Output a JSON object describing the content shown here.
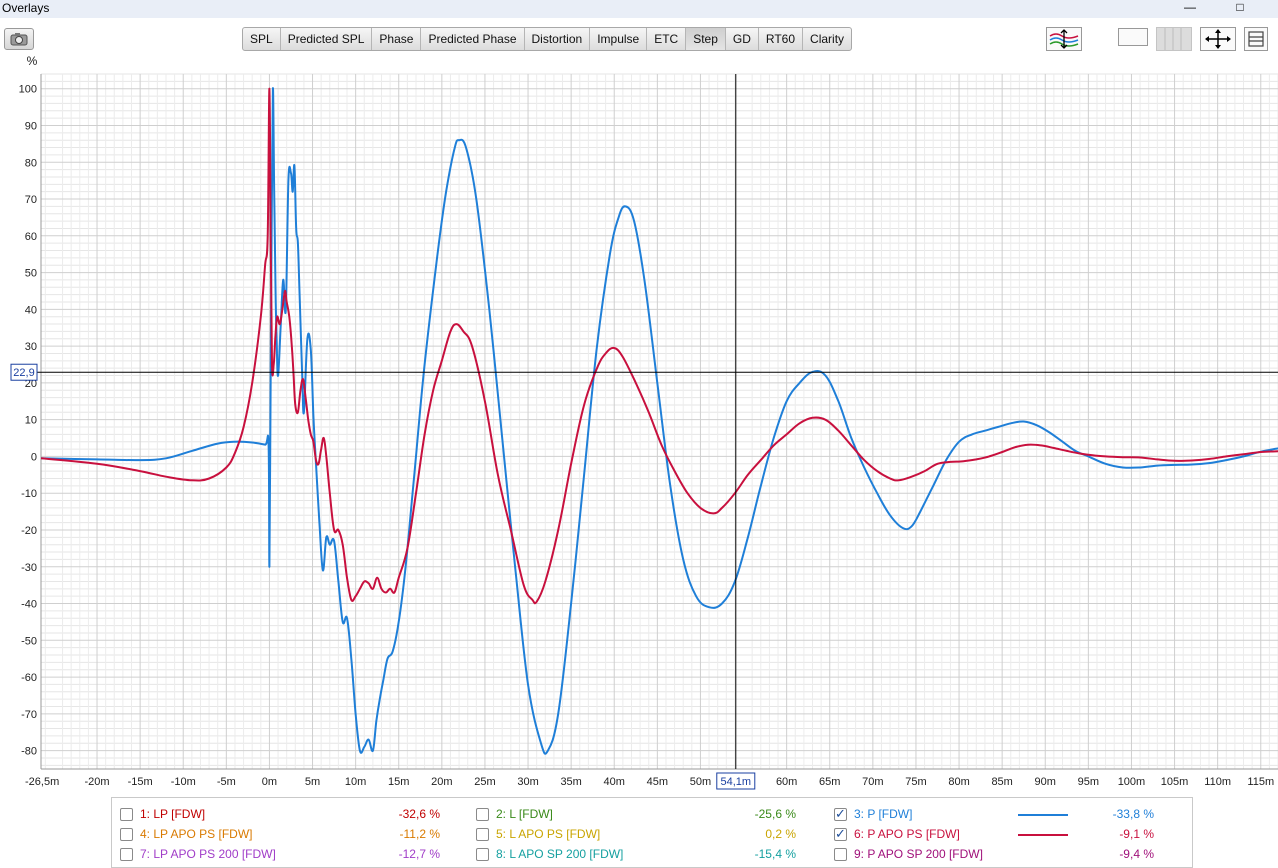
{
  "window": {
    "title": "Overlays",
    "minimize_glyph": "—",
    "maximize_glyph": "□"
  },
  "toolbar": {
    "tabs": [
      {
        "label": "SPL",
        "active": false
      },
      {
        "label": "Predicted SPL",
        "active": false
      },
      {
        "label": "Phase",
        "active": false
      },
      {
        "label": "Predicted Phase",
        "active": false
      },
      {
        "label": "Distortion",
        "active": false
      },
      {
        "label": "Impulse",
        "active": false
      },
      {
        "label": "ETC",
        "active": false
      },
      {
        "label": "Step",
        "active": true
      },
      {
        "label": "GD",
        "active": false
      },
      {
        "label": "RT60",
        "active": false
      },
      {
        "label": "Clarity",
        "active": false
      }
    ],
    "icons": [
      "camera-icon",
      "waveform-scale-icon",
      "color-swatch-icon",
      "grid-toggle-icon",
      "move-arrows-icon",
      "panel-icon"
    ]
  },
  "chart_data": {
    "type": "line",
    "ylabel": "%",
    "xlim": [
      -26.5,
      117
    ],
    "ylim": [
      -85,
      104
    ],
    "yticks": [
      -80,
      -70,
      -60,
      -50,
      -40,
      -30,
      -20,
      -10,
      0,
      10,
      20,
      30,
      40,
      50,
      60,
      70,
      80,
      90,
      100
    ],
    "xticks": [
      {
        "v": -26.5,
        "label": "-26,5m"
      },
      {
        "v": -20,
        "label": "-20m"
      },
      {
        "v": -15,
        "label": "-15m"
      },
      {
        "v": -10,
        "label": "-10m"
      },
      {
        "v": -5,
        "label": "-5m"
      },
      {
        "v": 0,
        "label": "0m"
      },
      {
        "v": 5,
        "label": "5m"
      },
      {
        "v": 10,
        "label": "10m"
      },
      {
        "v": 15,
        "label": "15m"
      },
      {
        "v": 20,
        "label": "20m"
      },
      {
        "v": 25,
        "label": "25m"
      },
      {
        "v": 30,
        "label": "30m"
      },
      {
        "v": 35,
        "label": "35m"
      },
      {
        "v": 40,
        "label": "40m"
      },
      {
        "v": 45,
        "label": "45m"
      },
      {
        "v": 50,
        "label": "50m"
      },
      {
        "v": 60,
        "label": "60m"
      },
      {
        "v": 65,
        "label": "65m"
      },
      {
        "v": 70,
        "label": "70m"
      },
      {
        "v": 75,
        "label": "75m"
      },
      {
        "v": 80,
        "label": "80m"
      },
      {
        "v": 85,
        "label": "85m"
      },
      {
        "v": 90,
        "label": "90m"
      },
      {
        "v": 95,
        "label": "95m"
      },
      {
        "v": 100,
        "label": "100m"
      },
      {
        "v": 105,
        "label": "105m"
      },
      {
        "v": 110,
        "label": "110m"
      },
      {
        "v": 115,
        "label": "115m"
      }
    ],
    "cursor": {
      "x": 54.1,
      "y": 22.9,
      "x_label": "54,1m",
      "y_label": "22,9"
    },
    "grid": true,
    "series": [
      {
        "name": "3: P [FDW]",
        "color": "#1f7fd8",
        "points": [
          [
            -26.5,
            -0.5
          ],
          [
            -20,
            -0.8
          ],
          [
            -15,
            -1
          ],
          [
            -12,
            -0.5
          ],
          [
            -9,
            1.5
          ],
          [
            -6,
            3.5
          ],
          [
            -4,
            4
          ],
          [
            -2,
            3.8
          ],
          [
            -0.5,
            3.2
          ],
          [
            -0.1,
            3
          ],
          [
            0,
            -30
          ],
          [
            0.1,
            5
          ],
          [
            0.25,
            60
          ],
          [
            0.4,
            100
          ],
          [
            0.55,
            72
          ],
          [
            0.7,
            46
          ],
          [
            0.85,
            30
          ],
          [
            1,
            22
          ],
          [
            1.3,
            35
          ],
          [
            1.6,
            48
          ],
          [
            1.9,
            40
          ],
          [
            2.2,
            75
          ],
          [
            2.5,
            77
          ],
          [
            2.7,
            72
          ],
          [
            2.9,
            79
          ],
          [
            3.1,
            62
          ],
          [
            3.3,
            58
          ],
          [
            3.5,
            44
          ],
          [
            3.8,
            22
          ],
          [
            4,
            12
          ],
          [
            4.4,
            32
          ],
          [
            4.8,
            29
          ],
          [
            5.1,
            11
          ],
          [
            5.4,
            -2
          ],
          [
            5.8,
            -18
          ],
          [
            6.2,
            -31
          ],
          [
            6.6,
            -22
          ],
          [
            7,
            -24
          ],
          [
            7.5,
            -23
          ],
          [
            8,
            -34
          ],
          [
            8.5,
            -45
          ],
          [
            9,
            -44
          ],
          [
            9.5,
            -55
          ],
          [
            10,
            -70
          ],
          [
            10.5,
            -80
          ],
          [
            11,
            -79
          ],
          [
            11.5,
            -77
          ],
          [
            12,
            -80
          ],
          [
            12.4,
            -72
          ],
          [
            12.8,
            -66
          ],
          [
            13.2,
            -61
          ],
          [
            13.7,
            -55
          ],
          [
            14.3,
            -53
          ],
          [
            15,
            -45
          ],
          [
            15.8,
            -30
          ],
          [
            16.8,
            -5
          ],
          [
            18,
            25
          ],
          [
            19.5,
            55
          ],
          [
            20.5,
            72
          ],
          [
            21.5,
            84
          ],
          [
            22,
            86
          ],
          [
            22.8,
            84
          ],
          [
            24,
            70
          ],
          [
            25.5,
            40
          ],
          [
            27,
            5
          ],
          [
            28.5,
            -30
          ],
          [
            30,
            -62
          ],
          [
            31.5,
            -78
          ],
          [
            32.3,
            -80
          ],
          [
            33.5,
            -70
          ],
          [
            35,
            -40
          ],
          [
            36.5,
            -5
          ],
          [
            38,
            30
          ],
          [
            39.5,
            55
          ],
          [
            40.5,
            65
          ],
          [
            41.3,
            68
          ],
          [
            42.3,
            64
          ],
          [
            43.5,
            48
          ],
          [
            45,
            20
          ],
          [
            46.5,
            -8
          ],
          [
            48,
            -28
          ],
          [
            49.5,
            -38
          ],
          [
            51,
            -41
          ],
          [
            52.5,
            -40
          ],
          [
            54,
            -34
          ],
          [
            55.5,
            -22
          ],
          [
            57,
            -8
          ],
          [
            58.5,
            5
          ],
          [
            60,
            15
          ],
          [
            61.5,
            20
          ],
          [
            63,
            23
          ],
          [
            64.5,
            22
          ],
          [
            66,
            15
          ],
          [
            67.5,
            5
          ],
          [
            69,
            -3
          ],
          [
            70.5,
            -10
          ],
          [
            72,
            -16
          ],
          [
            73.5,
            -19.5
          ],
          [
            74.5,
            -19
          ],
          [
            75.5,
            -15
          ],
          [
            77,
            -8
          ],
          [
            78.5,
            -1
          ],
          [
            80,
            4
          ],
          [
            81.5,
            6
          ],
          [
            83,
            7
          ],
          [
            84.5,
            8
          ],
          [
            86,
            9
          ],
          [
            87.5,
            9.5
          ],
          [
            89,
            8.5
          ],
          [
            90.5,
            6.5
          ],
          [
            92,
            4
          ],
          [
            93.5,
            1.5
          ],
          [
            95,
            0
          ],
          [
            97,
            -2
          ],
          [
            99,
            -3
          ],
          [
            101,
            -3
          ],
          [
            103,
            -2.5
          ],
          [
            105,
            -2.3
          ],
          [
            107,
            -2.2
          ],
          [
            109,
            -1.8
          ],
          [
            111,
            -1
          ],
          [
            113,
            0
          ],
          [
            115,
            1.3
          ],
          [
            117,
            2.2
          ]
        ]
      },
      {
        "name": "6: P APO PS [FDW]",
        "color": "#c8103e",
        "points": [
          [
            -26.5,
            -0.5
          ],
          [
            -20,
            -2
          ],
          [
            -15,
            -4
          ],
          [
            -12,
            -5.5
          ],
          [
            -9,
            -6.5
          ],
          [
            -7,
            -6
          ],
          [
            -5,
            -3
          ],
          [
            -4,
            1
          ],
          [
            -3,
            8
          ],
          [
            -2,
            20
          ],
          [
            -1,
            38
          ],
          [
            -0.5,
            52
          ],
          [
            -0.2,
            60
          ],
          [
            0,
            100
          ],
          [
            0.15,
            58
          ],
          [
            0.3,
            25
          ],
          [
            0.5,
            25
          ],
          [
            0.7,
            33
          ],
          [
            0.9,
            38
          ],
          [
            1.2,
            36
          ],
          [
            1.5,
            40
          ],
          [
            1.8,
            45
          ],
          [
            2,
            42
          ],
          [
            2.3,
            38
          ],
          [
            2.6,
            30
          ],
          [
            2.8,
            22
          ],
          [
            3,
            14
          ],
          [
            3.3,
            12
          ],
          [
            3.6,
            18
          ],
          [
            3.9,
            21
          ],
          [
            4.2,
            16
          ],
          [
            4.5,
            10
          ],
          [
            4.8,
            6
          ],
          [
            5.1,
            4
          ],
          [
            5.4,
            -1
          ],
          [
            5.7,
            -2
          ],
          [
            6,
            2
          ],
          [
            6.3,
            5
          ],
          [
            6.6,
            0
          ],
          [
            7,
            -10
          ],
          [
            7.5,
            -20
          ],
          [
            8,
            -20
          ],
          [
            8.5,
            -24
          ],
          [
            9,
            -33
          ],
          [
            9.5,
            -39
          ],
          [
            10,
            -38
          ],
          [
            10.5,
            -36
          ],
          [
            11,
            -34
          ],
          [
            11.5,
            -34.5
          ],
          [
            12,
            -36
          ],
          [
            12.5,
            -33
          ],
          [
            13,
            -36
          ],
          [
            13.5,
            -37
          ],
          [
            14,
            -36
          ],
          [
            14.5,
            -37
          ],
          [
            15,
            -33
          ],
          [
            16,
            -25
          ],
          [
            17,
            -10
          ],
          [
            18,
            6
          ],
          [
            19,
            18
          ],
          [
            20,
            26
          ],
          [
            21,
            34
          ],
          [
            21.7,
            36
          ],
          [
            22.5,
            34
          ],
          [
            23.5,
            30
          ],
          [
            25,
            15
          ],
          [
            26.5,
            -5
          ],
          [
            28,
            -20
          ],
          [
            29.5,
            -35
          ],
          [
            30.5,
            -39
          ],
          [
            31,
            -39.5
          ],
          [
            32,
            -34
          ],
          [
            33.5,
            -20
          ],
          [
            35,
            -2
          ],
          [
            36.5,
            14
          ],
          [
            38,
            24
          ],
          [
            39,
            28
          ],
          [
            40,
            29.5
          ],
          [
            41,
            27
          ],
          [
            42.5,
            20
          ],
          [
            44,
            12
          ],
          [
            45.5,
            3
          ],
          [
            47,
            -4
          ],
          [
            48.5,
            -10
          ],
          [
            50,
            -14
          ],
          [
            51.5,
            -15.5
          ],
          [
            52.5,
            -14
          ],
          [
            54,
            -10
          ],
          [
            55.5,
            -5
          ],
          [
            57,
            -1
          ],
          [
            58.5,
            3
          ],
          [
            60,
            6
          ],
          [
            61.5,
            9
          ],
          [
            63,
            10.5
          ],
          [
            64.5,
            10
          ],
          [
            66,
            7
          ],
          [
            67.5,
            3
          ],
          [
            69,
            -1
          ],
          [
            70.5,
            -4
          ],
          [
            72,
            -6
          ],
          [
            73,
            -6.5
          ],
          [
            74.5,
            -5.5
          ],
          [
            76,
            -4
          ],
          [
            77.5,
            -2
          ],
          [
            79,
            -1.5
          ],
          [
            80.5,
            -1.3
          ],
          [
            82,
            -0.8
          ],
          [
            83.5,
            0
          ],
          [
            85,
            1.2
          ],
          [
            86.5,
            2.5
          ],
          [
            88,
            3.2
          ],
          [
            89.5,
            3
          ],
          [
            91,
            2.3
          ],
          [
            92.5,
            1.5
          ],
          [
            94,
            0.8
          ],
          [
            95.5,
            0.3
          ],
          [
            97,
            0
          ],
          [
            99,
            -0.2
          ],
          [
            101,
            -0.3
          ],
          [
            103,
            -0.8
          ],
          [
            105,
            -1.2
          ],
          [
            107,
            -1.1
          ],
          [
            109,
            -0.7
          ],
          [
            111,
            0
          ],
          [
            113,
            0.6
          ],
          [
            115,
            1.2
          ],
          [
            117,
            1.4
          ]
        ]
      }
    ]
  },
  "legend": [
    {
      "label": "1: LP [FDW]",
      "value": "-32,6 %",
      "checked": false,
      "color": "#c00000",
      "line": false
    },
    {
      "label": "2: L [FDW]",
      "value": "-25,6 %",
      "checked": false,
      "color": "#3a8a1a",
      "line": false
    },
    {
      "label": "3: P [FDW]",
      "value": "-33,8 %",
      "checked": true,
      "color": "#1f7fd8",
      "line": true
    },
    {
      "label": "4: LP APO PS [FDW]",
      "value": "-11,2 %",
      "checked": false,
      "color": "#d97a00",
      "line": false
    },
    {
      "label": "5: L APO PS [FDW]",
      "value": "0,2 %",
      "checked": false,
      "color": "#c9a400",
      "line": false
    },
    {
      "label": "6: P APO PS [FDW]",
      "value": "-9,1 %",
      "checked": true,
      "color": "#c8103e",
      "line": true
    },
    {
      "label": "7: LP APO PS 200 [FDW]",
      "value": "-12,7 %",
      "checked": false,
      "color": "#a03cc8",
      "line": false
    },
    {
      "label": "8: L APO SP 200 [FDW]",
      "value": "-15,4 %",
      "checked": false,
      "color": "#15a0a0",
      "line": false
    },
    {
      "label": "9: P APO SP 200 [FDW]",
      "value": "-9,4 %",
      "checked": false,
      "color": "#a0107a",
      "line": false
    }
  ]
}
